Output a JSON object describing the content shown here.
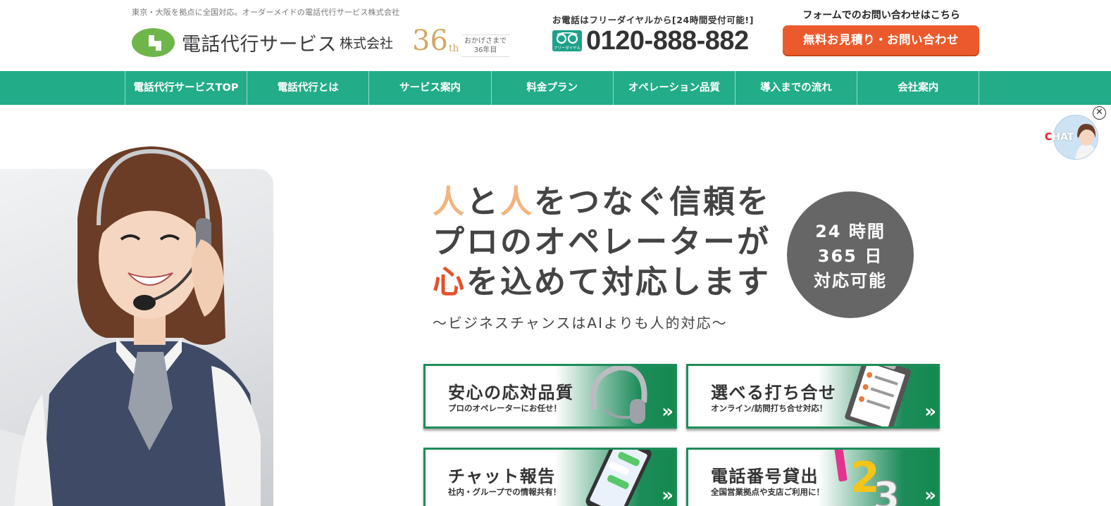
{
  "header": {
    "tagline": "東京・大阪を拠点に全国対応。オーダーメイドの電話代行サービス株式会社",
    "logo_name": "電話代行サービス",
    "logo_suffix": "株式会社",
    "anniversary_number": "36",
    "anniversary_suffix": "th",
    "anniversary_note_line1": "おかげさまで",
    "anniversary_note_line2": "36年目",
    "phone_lead": "お電話はフリーダイヤルから[24時間受付可能!]",
    "freedial_label": "フリーダイヤル",
    "phone_number": "0120-888-882",
    "form_lead": "フォームでのお問い合わせはこちら",
    "cta_label": "無料お見積り・お問い合わせ"
  },
  "nav": {
    "items": [
      {
        "label": "電話代行サービスTOP"
      },
      {
        "label": "電話代行とは"
      },
      {
        "label": "サービス案内"
      },
      {
        "label": "料金プラン"
      },
      {
        "label": "オペレーション品質"
      },
      {
        "label": "導入までの流れ"
      },
      {
        "label": "会社案内"
      }
    ]
  },
  "hero": {
    "headline": {
      "line1_a": "人",
      "line1_b": "と",
      "line1_c": "人",
      "line1_d": "をつなぐ信頼を",
      "line2": "プロのオペレーターが",
      "line3_a": "心",
      "line3_b": "を込めて対応します"
    },
    "subhead": "〜ビジネスチャンスはAIよりも人的対応〜",
    "badge": {
      "line1": "24 時間",
      "line2": "365 日",
      "line3": "対応可能"
    }
  },
  "cards": [
    {
      "title": "安心の応対品質",
      "sub": "プロのオペレーターにお任せ！",
      "icon": "headset-icon"
    },
    {
      "title": "選べる打ち合せ",
      "sub": "オンライン/訪問打ち合せ対応！",
      "icon": "clipboard-icon"
    },
    {
      "title": "チャット報告",
      "sub": "社内・グループでの情報共有！",
      "icon": "smartphone-chat-icon"
    },
    {
      "title": "電話番号貸出",
      "sub": "全国営業拠点や支店ご利用に！",
      "icon": "numbers-icon"
    }
  ],
  "chat": {
    "label_c": "C",
    "label_rest": "HAT",
    "close_glyph": "✕"
  },
  "colors": {
    "brand_green": "#22ac88",
    "cta_orange": "#eb5a2c",
    "accent_peach": "#f3b47d",
    "accent_red": "#e4512a",
    "card_green": "#1e8c5a",
    "badge_gray": "#666666"
  }
}
